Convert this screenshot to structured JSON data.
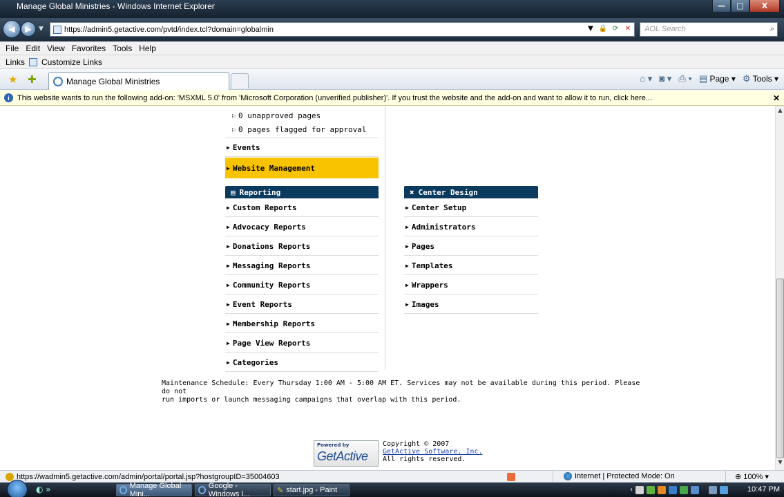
{
  "window": {
    "title": "Manage Global Ministries - Windows Internet Explorer",
    "min_glyph": "—",
    "max_glyph": "□",
    "close_glyph": "X"
  },
  "address": {
    "url": "https://admin5.getactive.com/pvtd/index.tcl?domain=globalmin",
    "search_placeholder": "AOL Search"
  },
  "menu": [
    "File",
    "Edit",
    "View",
    "Favorites",
    "Tools",
    "Help"
  ],
  "links": {
    "label": "Links",
    "customize": "Customize Links"
  },
  "tab": {
    "title": "Manage Global Ministries"
  },
  "commandbar": {
    "page": "Page",
    "tools": "Tools"
  },
  "infobar": {
    "message": "This website wants to run the following add-on: 'MSXML 5.0' from 'Microsoft Corporation (unverified publisher)'. If you trust the website and the add-on and want to allow it to run, click here..."
  },
  "content": {
    "unapproved": "0 unapproved pages",
    "flagged": "0 pages flagged for approval",
    "events": "Events",
    "website_management": "Website Management",
    "reporting": {
      "heading": "Reporting",
      "items": [
        "Custom Reports",
        "Advocacy Reports",
        "Donations Reports",
        "Messaging Reports",
        "Community Reports",
        "Event Reports",
        "Membership Reports",
        "Page View Reports",
        "Categories"
      ]
    },
    "center_design": {
      "heading": "Center Design",
      "items": [
        "Center Setup",
        "Administrators",
        "Pages",
        "Templates",
        "Wrappers",
        "Images"
      ]
    },
    "maintenance_line1": "Maintenance Schedule: Every Thursday 1:00 AM - 5:00 AM ET. Services may not be available during this period. Please do not",
    "maintenance_line2": "run imports or launch messaging campaigns that overlap with this period.",
    "footer": {
      "powered_by": "Powered by",
      "brand": "GetActive",
      "copyright": "Copyright © 2007",
      "company": "GetActive Software, Inc.",
      "rights": "All rights reserved."
    }
  },
  "statusbar": {
    "url": "https://wadmin5.getactive.com/admin/portal/portal.jsp?hostgroupID=35004603",
    "zone": "Internet | Protected Mode: On",
    "zoom": "100%"
  },
  "taskbar": {
    "tasks": [
      "Manage Global Mini...",
      "Google - Windows I...",
      "start.jpg - Paint"
    ],
    "clock": "10:47 PM"
  },
  "colors": {
    "highlight": "#f9c300",
    "panel_header": "#0a3b5e",
    "infobar": "#ffffe1"
  }
}
